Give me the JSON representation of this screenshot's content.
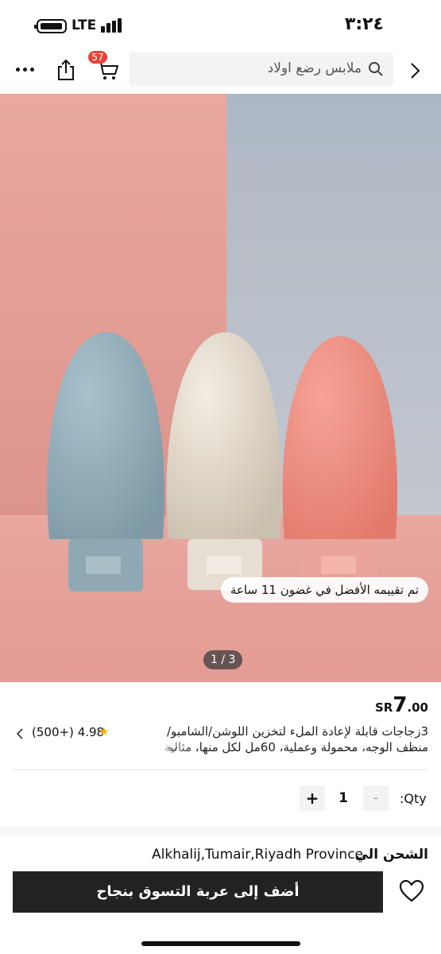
{
  "status_bar": {
    "time": "٣:٢٤",
    "network": "LTE"
  },
  "toolbar": {
    "search_placeholder": "ملابس رضع اولاد",
    "cart_count": "57",
    "icons": [
      "more-icon",
      "share-icon",
      "cart-icon",
      "search-icon",
      "back-icon"
    ]
  },
  "gallery": {
    "best_review_badge": "تم تقييمه الأفضل في غضون 11 ساعة",
    "pager": "1 / 3"
  },
  "product": {
    "currency": "SR",
    "price_int": "7",
    "price_dec": ".00",
    "title": "3زجاجات قابلة لإعادة الملء لتخزين اللوشن/الشامبو/منظف الوجه، محمولة وعملية، 60مل لكل منها، مثالية للسفر والأ",
    "rating": "4.98",
    "rating_count": "(500+)"
  },
  "quantity": {
    "label": ":Qty",
    "value": "1",
    "minus": "-",
    "plus": "+"
  },
  "shipping": {
    "label": "الشحن الي",
    "address": "Alkhalij,Tumair,Riyadh Province"
  },
  "cta": {
    "add_to_cart": "أضف إلى عربة التسوق بنجاح"
  },
  "colors": {
    "badge_red": "#e64539",
    "cta_black": "#222222",
    "star_yellow": "#f6b400"
  }
}
